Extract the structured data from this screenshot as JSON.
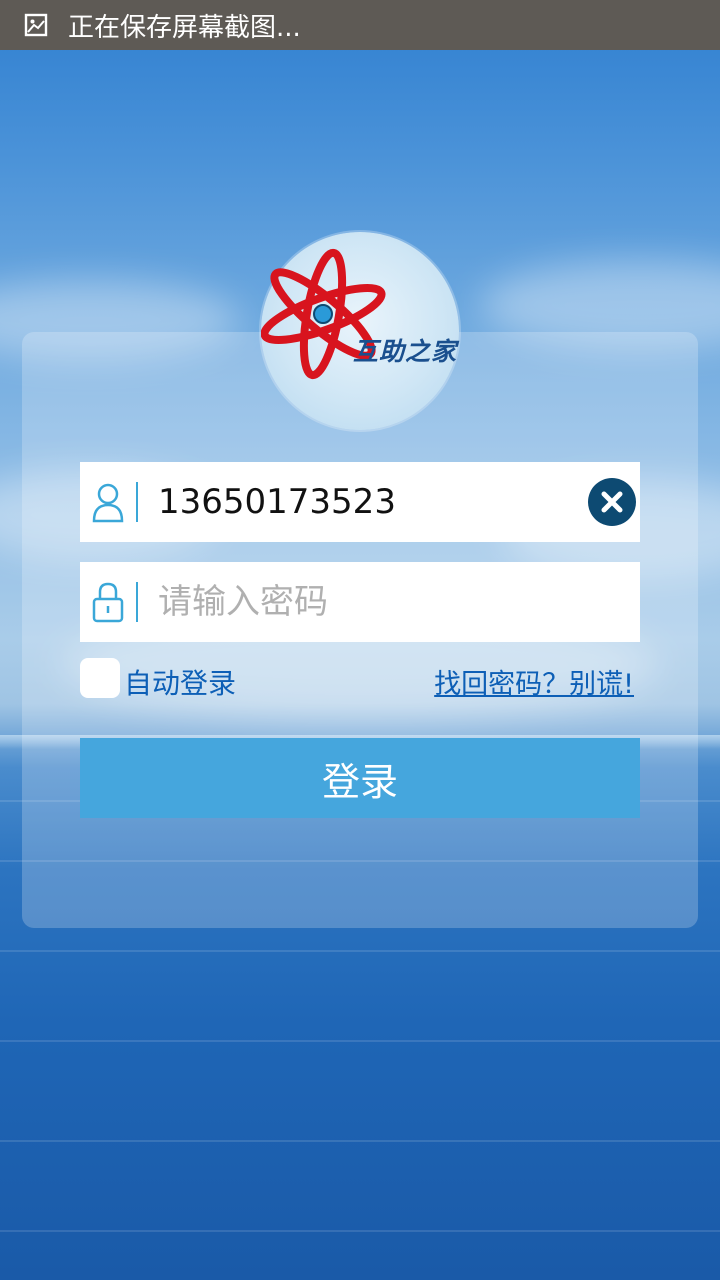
{
  "status_bar": {
    "notification_icon": "screenshot-icon",
    "text": "正在保存屏幕截图..."
  },
  "logo": {
    "icon": "atom-logo-icon",
    "text": "互助之家"
  },
  "username": {
    "icon": "user-icon",
    "value": "13650173523",
    "clear_icon": "clear-icon"
  },
  "password": {
    "icon": "lock-icon",
    "placeholder": "请输入密码"
  },
  "options": {
    "auto_login_label": "自动登录",
    "auto_login_checked": false,
    "forgot_link": "找回密码？别谎!"
  },
  "login_button": {
    "label": "登录"
  },
  "colors": {
    "status_bar_bg": "#5e5a55",
    "accent_button": "#45a6dd",
    "link": "#0d5fb6",
    "icon_outline": "#3aa7d8",
    "clear_button": "#0d4a72",
    "logo_red": "#d8141e"
  }
}
